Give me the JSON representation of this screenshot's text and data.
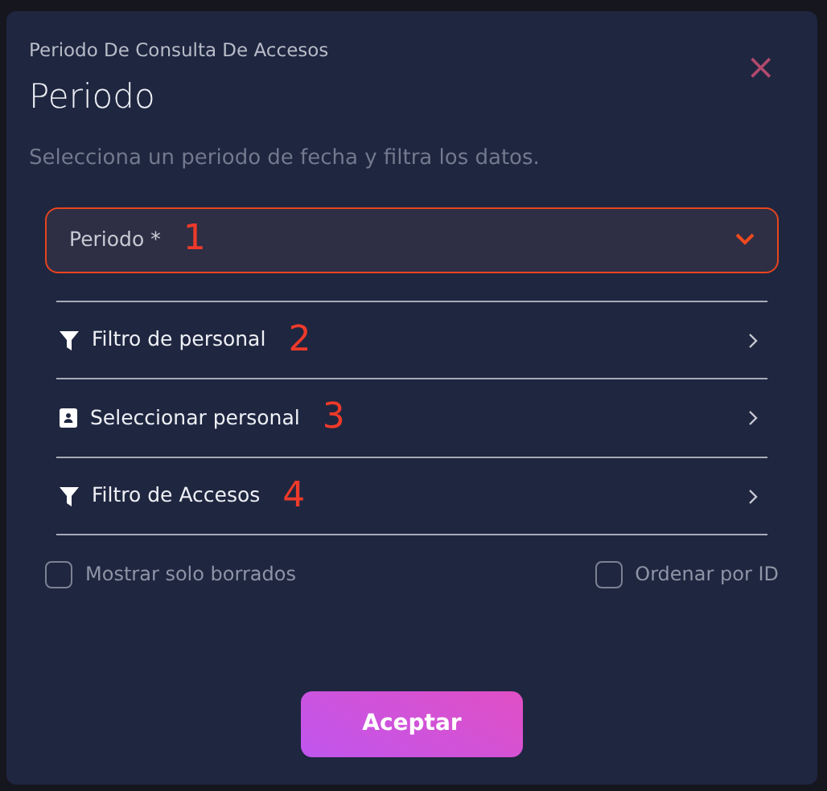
{
  "dialog": {
    "subtitle": "Periodo De Consulta De Accesos",
    "title": "Periodo",
    "description": "Selecciona un periodo de fecha y filtra los datos.",
    "close_label": "×"
  },
  "period_select": {
    "label": "Periodo *",
    "annotation": "1"
  },
  "menu_items": [
    {
      "kind": "filter",
      "label": "Filtro de personal",
      "annotation": "2"
    },
    {
      "kind": "contact",
      "label": "Seleccionar personal",
      "annotation": "3"
    },
    {
      "kind": "filter",
      "label": "Filtro de Accesos",
      "annotation": "4"
    }
  ],
  "checkboxes": [
    {
      "label": "Mostrar solo borrados",
      "checked": false
    },
    {
      "label": "Ordenar por ID",
      "checked": false
    }
  ],
  "button": {
    "label": "Aceptar"
  }
}
